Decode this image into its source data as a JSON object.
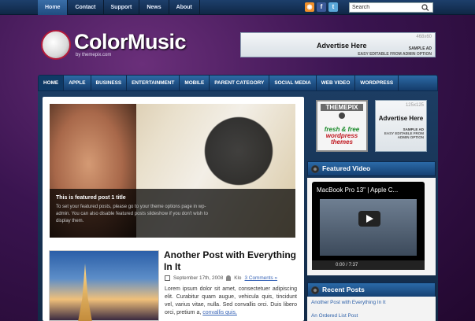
{
  "topnav": [
    {
      "label": "Home"
    },
    {
      "label": "Contact"
    },
    {
      "label": "Support"
    },
    {
      "label": "News"
    },
    {
      "label": "About"
    }
  ],
  "search": {
    "value": "Search"
  },
  "logo": {
    "title": "ColorMusic",
    "sub": "by themepix.com"
  },
  "ad_banner": {
    "dim": "468x60",
    "main": "Advertise Here",
    "s1": "SAMPLE AD",
    "s2": "EASY EDITABLE FROM ADMIN OPTION"
  },
  "mainnav": [
    {
      "label": "HOME"
    },
    {
      "label": "APPLE"
    },
    {
      "label": "BUSINESS"
    },
    {
      "label": "ENTERTAINMENT"
    },
    {
      "label": "MOBILE"
    },
    {
      "label": "PARENT CATEGORY"
    },
    {
      "label": "SOCIAL MEDIA"
    },
    {
      "label": "WEB VIDEO"
    },
    {
      "label": "WORDPRESS"
    }
  ],
  "slider": {
    "title": "This is featured post 1 title",
    "desc": "To set your featured posts, please go to your theme options page in wp-admin. You can also disable featured posts slideshow if you don't wish to display them."
  },
  "post": {
    "title": "Another Post with Everything In It",
    "date": "September 17th, 2008",
    "author": "Klo",
    "comments": "3 Comments »",
    "text": "Lorem ipsum dolor sit amet, consectetuer adipiscing elit. Curabitur quam augue, vehicula quis, tincidunt vel, varius vitae, nulla. Sed convallis orci. Duis libero orci, pretium a,",
    "link": "convallis quis,"
  },
  "ad125a": {
    "a1": "THEMEPIX",
    "a2": "fresh & free",
    "a3": "wordpress",
    "a4": "themes"
  },
  "ad125b": {
    "dim": "125x125",
    "main": "Advertise Here",
    "s1": "SAMPLE AD",
    "s2": "EASY EDITABLE FROM ADMIN OPTION"
  },
  "featured_video": {
    "heading": "Featured Video",
    "title": "MacBook Pro 13\" | Apple C...",
    "time": "0:00 / 7:37"
  },
  "recent_posts": {
    "heading": "Recent Posts",
    "items": [
      "Another Post with Everything In It",
      "An Ordered List Post"
    ]
  }
}
